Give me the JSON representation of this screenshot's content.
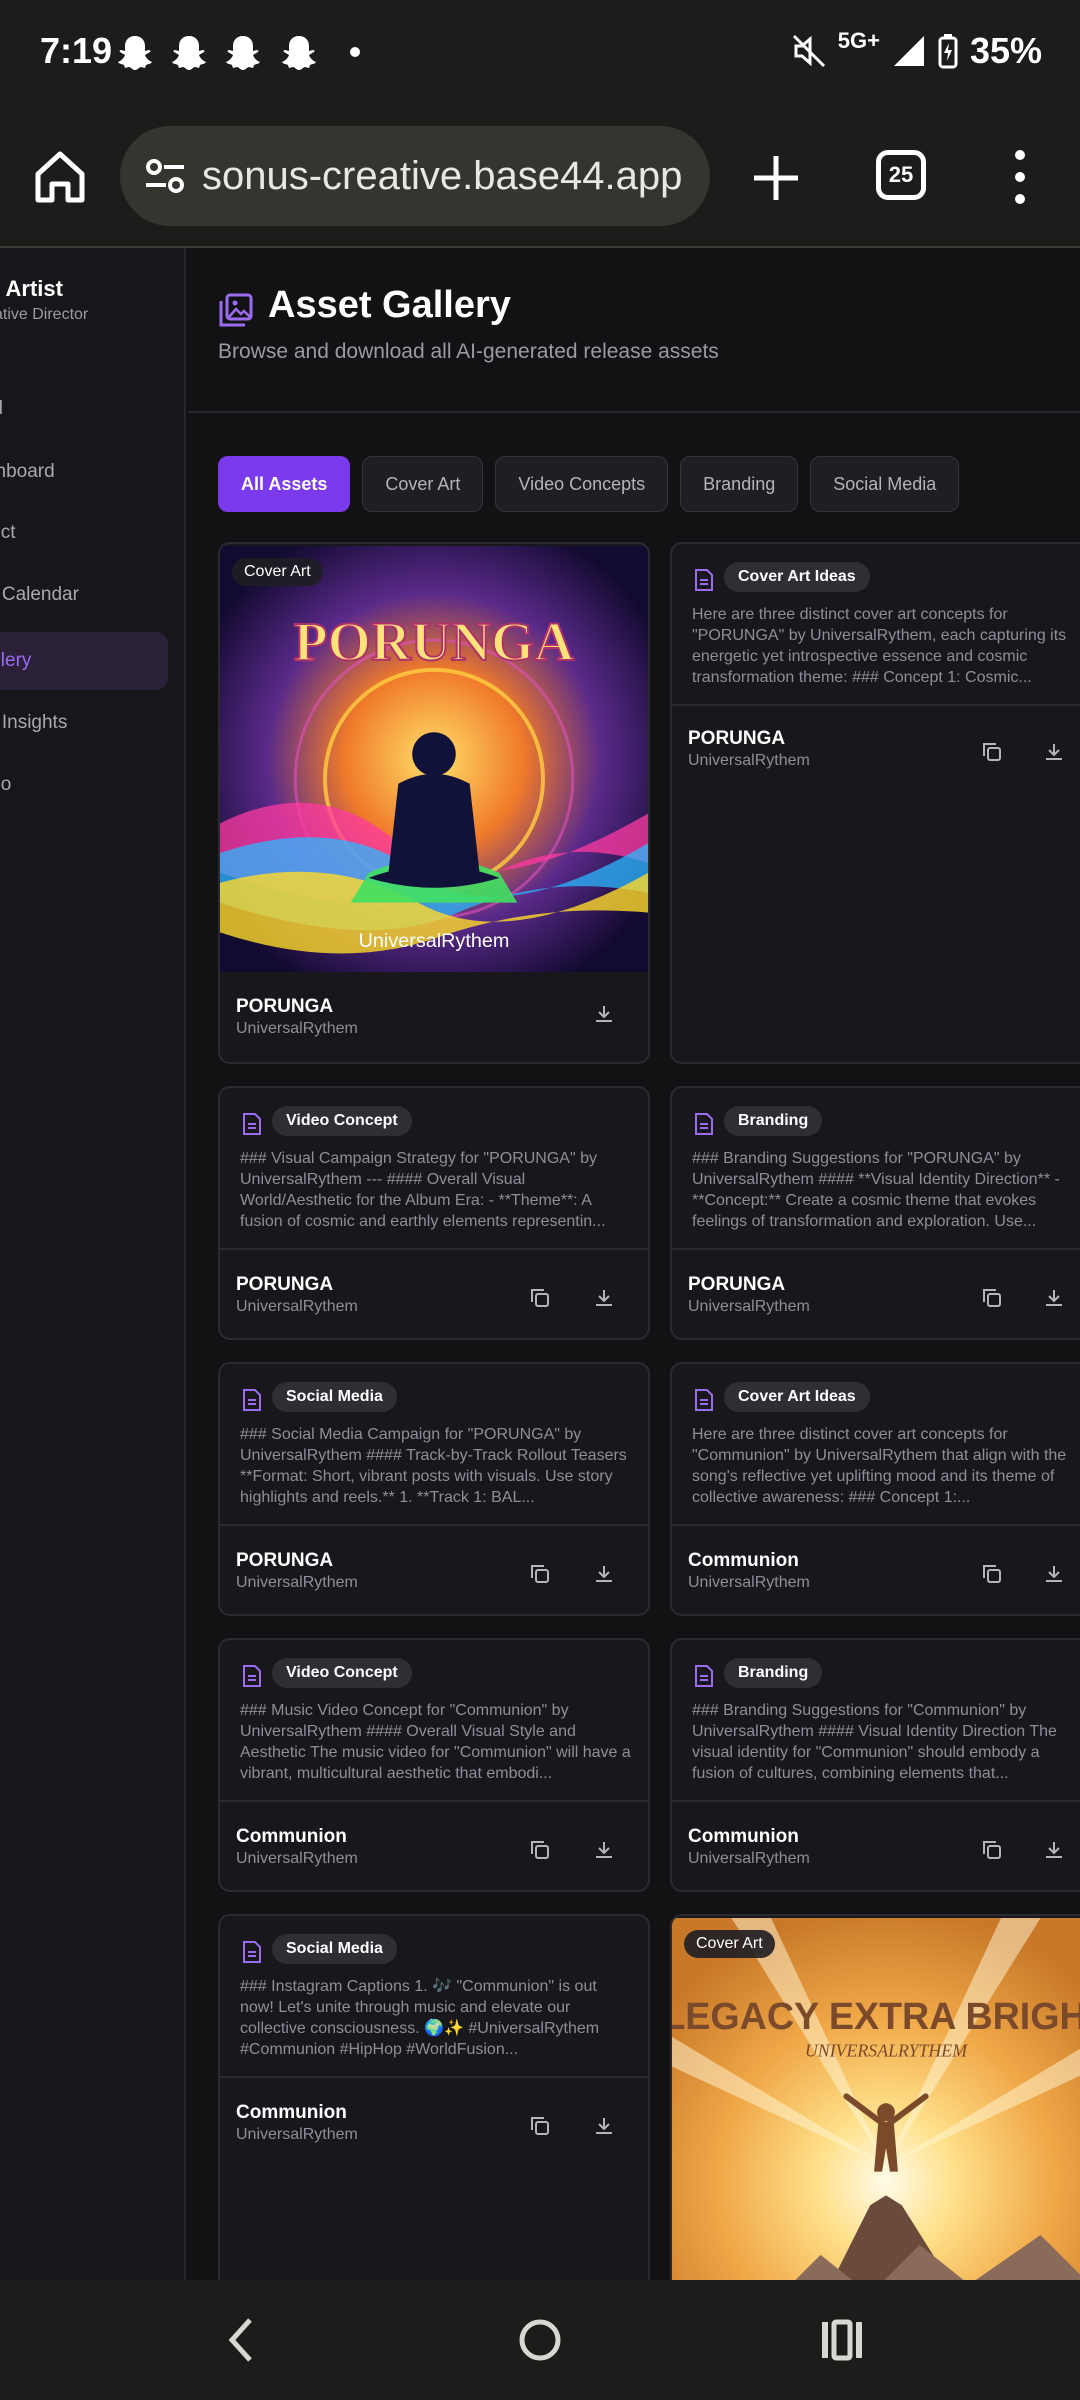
{
  "status_bar": {
    "time": "7:19",
    "network": "5G+",
    "battery": "35%"
  },
  "browser": {
    "url": "sonus-creative.base44.app",
    "tab_count": "25"
  },
  "sidebar": {
    "artist_name": "e Artist",
    "artist_role": "ative Director",
    "items": [
      {
        "label": "rd"
      },
      {
        "label": "shboard"
      },
      {
        "label": "ject"
      },
      {
        "label": "g Calendar"
      },
      {
        "label": "allery"
      },
      {
        "label": "e Insights"
      },
      {
        "label": "dio"
      }
    ]
  },
  "header": {
    "title": "Asset Gallery",
    "subtitle": "Browse and download all AI-generated release assets"
  },
  "filters": [
    "All Assets",
    "Cover Art",
    "Video Concepts",
    "Branding",
    "Social Media"
  ],
  "cards": [
    {
      "type": "Cover Art",
      "image_title": "PORUNGA",
      "image_artist": "UniversalRythem",
      "title": "PORUNGA",
      "artist": "UniversalRythem"
    },
    {
      "type": "Cover Art Ideas",
      "excerpt": "Here are three distinct cover art concepts for \"PORUNGA\" by UniversalRythem, each capturing its energetic yet introspective essence and cosmic transformation theme: ### Concept 1: Cosmic...",
      "title": "PORUNGA",
      "artist": "UniversalRythem"
    },
    {
      "type": "Video Concept",
      "excerpt": "### Visual Campaign Strategy for \"PORUNGA\" by UniversalRythem --- #### Overall Visual World/Aesthetic for the Album Era: - **Theme**: A fusion of cosmic and earthly elements representin...",
      "title": "PORUNGA",
      "artist": "UniversalRythem"
    },
    {
      "type": "Branding",
      "excerpt": "### Branding Suggestions for \"PORUNGA\" by UniversalRythem #### **Visual Identity Direction** - **Concept:** Create a cosmic theme that evokes feelings of transformation and exploration. Use...",
      "title": "PORUNGA",
      "artist": "UniversalRythem"
    },
    {
      "type": "Social Media",
      "excerpt": "### Social Media Campaign for \"PORUNGA\" by UniversalRythem #### Track-by-Track Rollout Teasers **Format: Short, vibrant posts with visuals. Use story highlights and reels.** 1. **Track 1: BAL...",
      "title": "PORUNGA",
      "artist": "UniversalRythem"
    },
    {
      "type": "Cover Art Ideas",
      "excerpt": "Here are three distinct cover art concepts for \"Communion\" by UniversalRythem that align with the song's reflective yet uplifting mood and its theme of collective awareness: ### Concept 1:...",
      "title": "Communion",
      "artist": "UniversalRythem"
    },
    {
      "type": "Video Concept",
      "excerpt": "### Music Video Concept for \"Communion\" by UniversalRythem #### Overall Visual Style and Aesthetic The music video for \"Communion\" will have a vibrant, multicultural aesthetic that embodi...",
      "title": "Communion",
      "artist": "UniversalRythem"
    },
    {
      "type": "Branding",
      "excerpt": "### Branding Suggestions for \"Communion\" by UniversalRythem #### Visual Identity Direction The visual identity for \"Communion\" should embody a fusion of cultures, combining elements that...",
      "title": "Communion",
      "artist": "UniversalRythem"
    },
    {
      "type": "Social Media",
      "excerpt": "### Instagram Captions 1. 🎶 \"Communion\" is out now! Let's unite through music and elevate our collective consciousness. 🌍✨ #UniversalRythem #Communion #HipHop #WorldFusion...",
      "title": "Communion",
      "artist": "UniversalRythem"
    },
    {
      "type": "Cover Art",
      "image_title": "LEGACY EXTRA BRIGHT",
      "image_artist": "UNIVERSALRYTHEM"
    }
  ],
  "colors": {
    "accent": "#7c3aed",
    "background": "#121215",
    "card": "#18181c"
  }
}
